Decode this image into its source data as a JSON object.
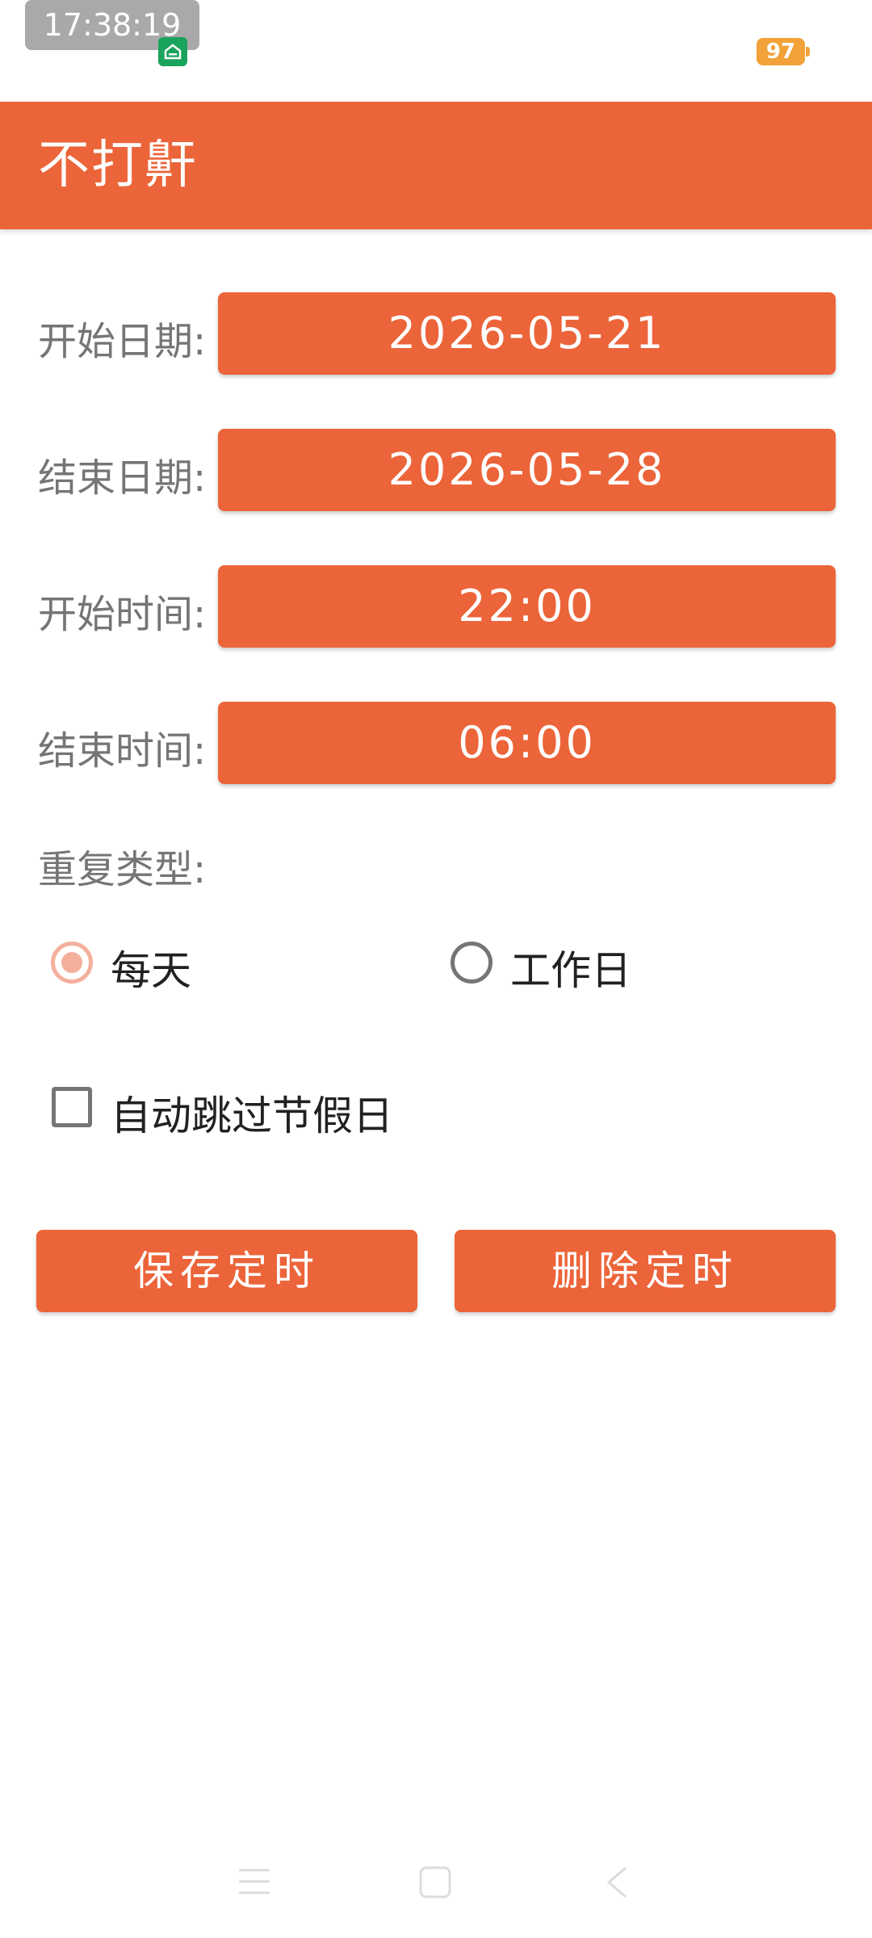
{
  "status_bar": {
    "time": "17:38:19",
    "battery": "97",
    "icons": [
      "home-app-icon",
      "battery-icon"
    ]
  },
  "app_bar": {
    "title": "不打鼾"
  },
  "form": {
    "start_date_label": "开始日期:",
    "start_date_value": "2026-05-21",
    "end_date_label": "结束日期:",
    "end_date_value": "2026-05-28",
    "start_time_label": "开始时间:",
    "start_time_value": "22:00",
    "end_time_label": "结束时间:",
    "end_time_value": "06:00",
    "repeat_label": "重复类型:",
    "repeat_options": [
      {
        "label": "每天",
        "checked": true
      },
      {
        "label": "工作日",
        "checked": false
      }
    ],
    "skip_holidays_label": "自动跳过节假日",
    "skip_holidays_checked": false
  },
  "actions": {
    "save_label": "保存定时",
    "delete_label": "删除定时"
  },
  "nav_bar": {
    "icons": [
      "menu-icon",
      "home-icon",
      "back-icon"
    ]
  },
  "colors": {
    "primary": "#ec6439",
    "radio_checked": "#f4b09c",
    "label_gray": "#757575"
  }
}
